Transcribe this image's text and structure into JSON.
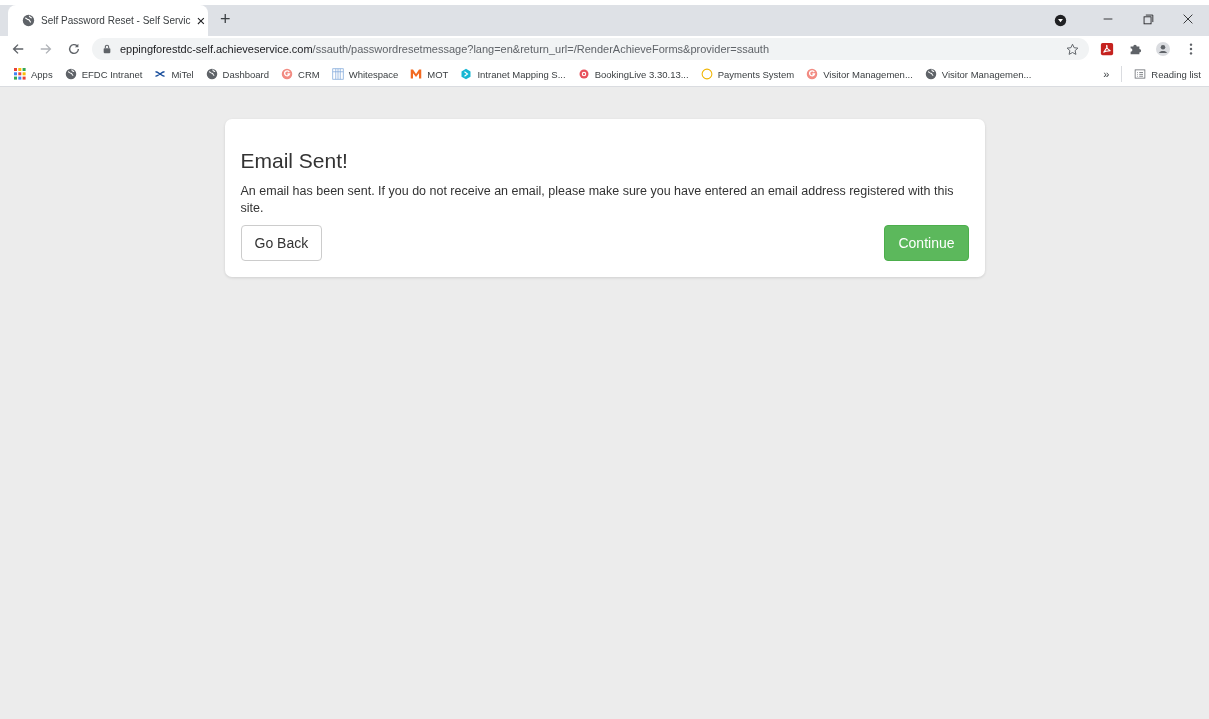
{
  "tab": {
    "title": "Self Password Reset - Self Servic",
    "close": "×",
    "new": "+"
  },
  "address": {
    "host": "eppingforestdc-self.achieveservice.com",
    "path": "/ssauth/passwordresetmessage?lang=en&return_url=/RenderAchieveForms&provider=ssauth"
  },
  "bookmarks": [
    {
      "label": "Apps",
      "kind": "grid"
    },
    {
      "label": "EFDC Intranet",
      "kind": "globe"
    },
    {
      "label": "MiTel",
      "kind": "loop"
    },
    {
      "label": "Dashboard",
      "kind": "globe"
    },
    {
      "label": "CRM",
      "kind": "g"
    },
    {
      "label": "Whitespace",
      "kind": "columns"
    },
    {
      "label": "MOT",
      "kind": "m"
    },
    {
      "label": "Intranet Mapping S...",
      "kind": "hex"
    },
    {
      "label": "BookingLive 3.30.13...",
      "kind": "target"
    },
    {
      "label": "Payments System",
      "kind": "ring"
    },
    {
      "label": "Visitor Managemen...",
      "kind": "g"
    },
    {
      "label": "Visitor Managemen...",
      "kind": "globe"
    }
  ],
  "bookmarks_more": "»",
  "reading_list": "Reading list",
  "card": {
    "heading": "Email Sent!",
    "message": "An email has been sent. If you do not receive an email, please make sure you have entered an email address registered with this site.",
    "buttons": [
      {
        "label": "Go Back",
        "kind": "default"
      },
      {
        "label": "Continue",
        "kind": "success"
      }
    ]
  }
}
